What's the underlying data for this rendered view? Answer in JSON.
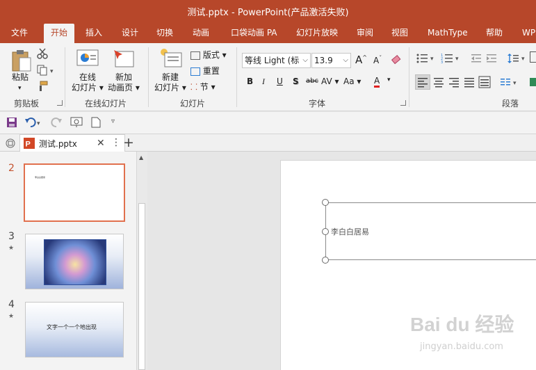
{
  "window": {
    "title": "测试.pptx  -  PowerPoint(产品激活失败)"
  },
  "tabs": [
    "文件",
    "开始",
    "插入",
    "设计",
    "切换",
    "动画",
    "口袋动画 PA",
    "幻灯片放映",
    "审阅",
    "视图",
    "MathType",
    "帮助",
    "WPS"
  ],
  "active_tab": "开始",
  "ribbon": {
    "clipboard": {
      "paste": "粘贴",
      "label": "剪贴板"
    },
    "online_slides": {
      "online_btn": [
        "在线",
        "幻灯片"
      ],
      "anim_btn": [
        "新加",
        "动画页"
      ],
      "label": "在线幻灯片"
    },
    "slides": {
      "new_btn": [
        "新建",
        "幻灯片"
      ],
      "layout": "版式",
      "reset": "重置",
      "section": "节",
      "label": "幻灯片"
    },
    "font": {
      "name": "等线 Light (标",
      "size": "13.9",
      "label": "字体",
      "bold": "B",
      "italic": "I",
      "underline": "U",
      "shadow": "S",
      "strike": "abc",
      "spacing": "AV",
      "case": "Aa",
      "color_letter": "A",
      "grow": "A",
      "shrink": "A"
    },
    "paragraph": {
      "label": "段落"
    }
  },
  "doc_tab": {
    "name": "测试.pptx"
  },
  "thumbnails": [
    {
      "num": "2",
      "selected": true,
      "star": "",
      "caption": "李白白居易"
    },
    {
      "num": "3",
      "selected": false,
      "star": "★",
      "caption": ""
    },
    {
      "num": "4",
      "selected": false,
      "star": "★",
      "caption": "文字一个一个地出现"
    }
  ],
  "slide": {
    "text": "李白白居易"
  },
  "watermark": {
    "brand": "Bai du 经验",
    "url": "jingyan.baidu.com"
  },
  "colors": {
    "accent": "#b7472a",
    "selection": "#e1704d"
  }
}
